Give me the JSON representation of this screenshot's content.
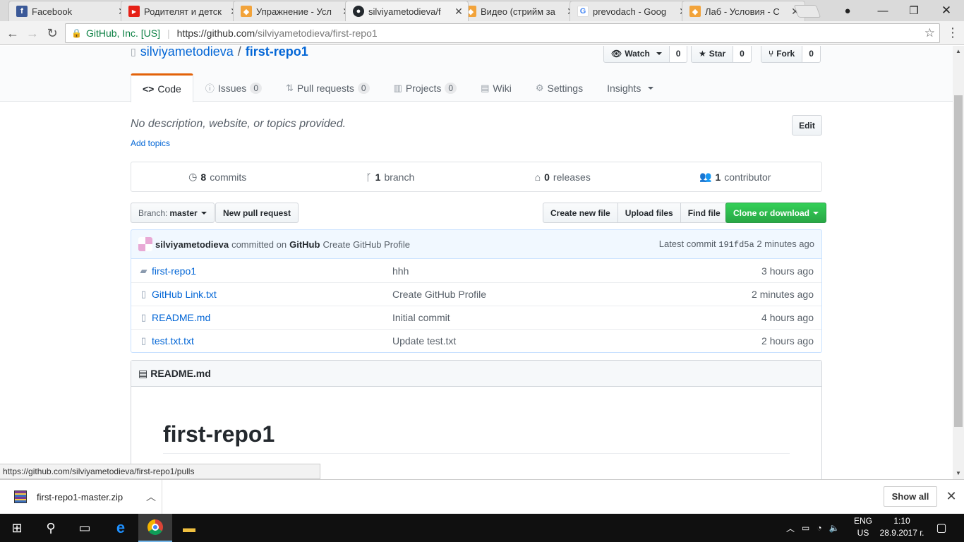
{
  "browser": {
    "tabs": [
      {
        "title": "Facebook",
        "icon": "facebook-icon",
        "color": "#3b5998",
        "glyph": "f"
      },
      {
        "title": "Родителят и детск",
        "icon": "youtube-icon",
        "color": "#e62117",
        "glyph": "▶"
      },
      {
        "title": "Упражнение - Усл",
        "icon": "softuni-icon",
        "color": "#f2a33a",
        "glyph": "◆"
      },
      {
        "title": "silviyametodieva/f",
        "icon": "github-icon",
        "color": "#24292e",
        "glyph": "●"
      },
      {
        "title": "Видео (стрийм за",
        "icon": "softuni-icon",
        "color": "#f2a33a",
        "glyph": "◆"
      },
      {
        "title": "prevodach - Goog",
        "icon": "google-icon",
        "color": "#4285f4",
        "glyph": "G"
      },
      {
        "title": "Лаб - Условия - С",
        "icon": "softuni-icon",
        "color": "#f2a33a",
        "glyph": "◆"
      }
    ],
    "secure_label": "GitHub, Inc. [US]",
    "url_host": "https://github.com",
    "url_path": "/silviyametodieva/first-repo1",
    "status_url": "https://github.com/silviyametodieva/first-repo1/pulls"
  },
  "repo": {
    "owner": "silviyametodieva",
    "separator": "/",
    "name": "first-repo1",
    "watch_label": "Watch",
    "watch_count": "0",
    "star_label": "Star",
    "star_count": "0",
    "fork_label": "Fork",
    "fork_count": "0",
    "nav": {
      "code": "Code",
      "issues": "Issues",
      "issues_count": "0",
      "pulls": "Pull requests",
      "pulls_count": "0",
      "projects": "Projects",
      "projects_count": "0",
      "wiki": "Wiki",
      "settings": "Settings",
      "insights": "Insights"
    },
    "description": "No description, website, or topics provided.",
    "add_topics": "Add topics",
    "edit_label": "Edit",
    "summary": {
      "commits_num": "8",
      "commits_label": "commits",
      "branch_num": "1",
      "branch_label": "branch",
      "releases_num": "0",
      "releases_label": "releases",
      "contrib_num": "1",
      "contrib_label": "contributor"
    },
    "branch_prefix": "Branch:",
    "branch_name": "master",
    "new_pr": "New pull request",
    "create_file": "Create new file",
    "upload_files": "Upload files",
    "find_file": "Find file",
    "clone": "Clone or download",
    "commit": {
      "user": "silviyametodieva",
      "committed_on": "committed on",
      "platform": "GitHub",
      "message": "Create GitHub Profile",
      "latest_label": "Latest commit",
      "sha": "191fd5a",
      "age": "2 minutes ago"
    },
    "files": [
      {
        "name": "first-repo1",
        "type": "dir",
        "message": "hhh",
        "age": "3 hours ago"
      },
      {
        "name": "GitHub Link.txt",
        "type": "file",
        "message": "Create GitHub Profile",
        "age": "2 minutes ago"
      },
      {
        "name": "README.md",
        "type": "file",
        "message": "Initial commit",
        "age": "4 hours ago"
      },
      {
        "name": "test.txt.txt",
        "type": "file",
        "message": "Update test.txt",
        "age": "2 hours ago"
      }
    ],
    "readme_label": "README.md",
    "readme_heading": "first-repo1"
  },
  "downloads": {
    "file": "first-repo1-master.zip",
    "show_all": "Show all"
  },
  "taskbar": {
    "lang_top": "ENG",
    "lang_bottom": "US",
    "time": "1:10",
    "date": "28.9.2017 г."
  }
}
